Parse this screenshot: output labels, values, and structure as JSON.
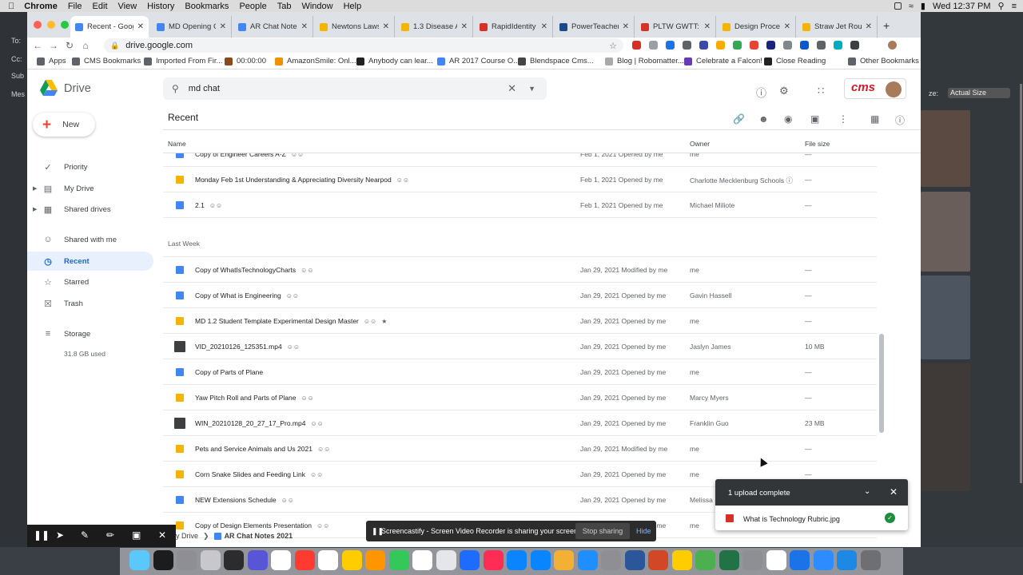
{
  "menubar": {
    "app": "Chrome",
    "items": [
      "File",
      "Edit",
      "View",
      "History",
      "Bookmarks",
      "People",
      "Tab",
      "Window",
      "Help"
    ],
    "clock": "Wed 12:37 PM"
  },
  "tabs": [
    {
      "label": "Recent - Google",
      "color": "#4285f4",
      "active": true
    },
    {
      "label": "MD Opening Cl",
      "color": "#4285f4"
    },
    {
      "label": "AR Chat Notes",
      "color": "#4285f4"
    },
    {
      "label": "Newtons Laws",
      "color": "#f4b400"
    },
    {
      "label": "1.3 Disease Ag",
      "color": "#f4b400"
    },
    {
      "label": "RapidIdentity",
      "color": "#d93025"
    },
    {
      "label": "PowerTeacher",
      "color": "#1a4a8c"
    },
    {
      "label": "PLTW GWTT: A",
      "color": "#d93025"
    },
    {
      "label": "Design Process",
      "color": "#f4b400"
    },
    {
      "label": "Straw Jet Roug",
      "color": "#f4b400"
    }
  ],
  "address": {
    "url": "drive.google.com"
  },
  "bookmarks": [
    {
      "label": "Apps",
      "color": "#5f6368"
    },
    {
      "label": "CMS Bookmarks",
      "color": "#5f6368"
    },
    {
      "label": "Imported From Fir...",
      "color": "#5f6368"
    },
    {
      "label": "00:00:00",
      "color": "#8a4b1c"
    },
    {
      "label": "AmazonSmile: Onl...",
      "color": "#f29100"
    },
    {
      "label": "Anybody can lear...",
      "color": "#222"
    },
    {
      "label": "AR 2017 Course O...",
      "color": "#4285f4"
    },
    {
      "label": "Blendspace Cms...",
      "color": "#444"
    },
    {
      "label": "Blog | Robomatter...",
      "color": "#aaa"
    },
    {
      "label": "Celebrate a Falcon!",
      "color": "#673ab7"
    },
    {
      "label": "Close Reading",
      "color": "#222"
    },
    {
      "label": "Other Bookmarks",
      "color": "#5f6368"
    }
  ],
  "drive": {
    "title": "Drive",
    "search_value": "md chat",
    "brand": "cms",
    "new_label": "New",
    "page_title": "Recent",
    "storage_used": "31.8 GB used"
  },
  "sidebar": [
    {
      "label": "Priority",
      "icon": "✓"
    },
    {
      "label": "My Drive",
      "icon": "▤",
      "arrow": true
    },
    {
      "label": "Shared drives",
      "icon": "▦",
      "arrow": true
    },
    {
      "label": "Shared with me",
      "icon": "☺"
    },
    {
      "label": "Recent",
      "icon": "◷",
      "active": true
    },
    {
      "label": "Starred",
      "icon": "☆"
    },
    {
      "label": "Trash",
      "icon": "☒"
    },
    {
      "label": "Storage",
      "icon": "≡"
    }
  ],
  "columns": {
    "name": "Name",
    "owner": "Owner",
    "size": "File size"
  },
  "section_last_week": "Last Week",
  "rows_top": [
    {
      "name": "Copy of Engineer Careers A-Z",
      "type": "doc",
      "shared": true,
      "modified": "Feb 1, 2021",
      "action": "Opened by me",
      "owner": "me",
      "size": "—"
    },
    {
      "name": "Monday Feb 1st Understanding & Appreciating Diversity Nearpod",
      "type": "slide",
      "shared": true,
      "modified": "Feb 1, 2021",
      "action": "Opened by me",
      "owner": "Charlotte Mecklenburg Schools",
      "size": "—"
    },
    {
      "name": "2.1",
      "type": "doc",
      "shared": true,
      "modified": "Feb 1, 2021",
      "action": "Opened by me",
      "owner": "Michael Miliote",
      "size": "—"
    }
  ],
  "rows_week": [
    {
      "name": "Copy of WhatIsTechnologyCharts",
      "type": "doc",
      "shared": true,
      "modified": "Jan 29, 2021",
      "action": "Modified by me",
      "owner": "me",
      "size": "—"
    },
    {
      "name": "Copy of What is Engineering",
      "type": "doc",
      "shared": true,
      "modified": "Jan 29, 2021",
      "action": "Opened by me",
      "owner": "Gavin Hassell",
      "size": "—"
    },
    {
      "name": "MD 1.2 Student Template Experimental Design Master",
      "type": "slide",
      "shared": true,
      "modified": "Jan 29, 2021",
      "action": "Opened by me",
      "owner": "me",
      "size": "—"
    },
    {
      "name": "VID_20210126_125351.mp4",
      "type": "vid",
      "shared": true,
      "modified": "Jan 29, 2021",
      "action": "Opened by me",
      "owner": "Jaslyn James",
      "size": "10 MB"
    },
    {
      "name": "Copy of Parts of Plane",
      "type": "doc",
      "shared": false,
      "modified": "Jan 29, 2021",
      "action": "Opened by me",
      "owner": "me",
      "size": "—"
    },
    {
      "name": "Yaw Pitch Roll and Parts of Plane",
      "type": "slide",
      "shared": true,
      "modified": "Jan 29, 2021",
      "action": "Opened by me",
      "owner": "Marcy Myers",
      "size": "—"
    },
    {
      "name": "WIN_20210128_20_27_17_Pro.mp4",
      "type": "vid",
      "shared": true,
      "modified": "Jan 29, 2021",
      "action": "Opened by me",
      "owner": "Franklin Guo",
      "size": "23 MB"
    },
    {
      "name": "Pets and Service Animals and Us 2021",
      "type": "slide",
      "shared": true,
      "modified": "Jan 29, 2021",
      "action": "Modified by me",
      "owner": "me",
      "size": "—"
    },
    {
      "name": "Corn Snake Slides and Feeding Link",
      "type": "slide",
      "shared": true,
      "modified": "Jan 29, 2021",
      "action": "Opened by me",
      "owner": "me",
      "size": "—"
    },
    {
      "name": "NEW Extensions Schedule",
      "type": "doc",
      "shared": true,
      "modified": "Jan 29, 2021",
      "action": "Opened by me",
      "owner": "Melissa",
      "size": ""
    },
    {
      "name": "Copy of Design Elements Presentation",
      "type": "slide",
      "shared": true,
      "modified": "Jan 28, 2021",
      "action": "Opened by me",
      "owner": "me",
      "size": ""
    }
  ],
  "upload": {
    "title": "1 upload complete",
    "file": "What is Technology Rubric.jpg"
  },
  "screencastify": {
    "text": "Screencastify - Screen Video Recorder is sharing your screen.",
    "stop": "Stop sharing",
    "hide": "Hide"
  },
  "breadcrumb": {
    "parent": "y Drive",
    "current": "AR Chat Notes 2021"
  },
  "desktop": {
    "size_label": "ze:",
    "size_value": "Actual Size",
    "left_labels": [
      "To:",
      "Cc:",
      "Sub",
      "Mes"
    ]
  }
}
